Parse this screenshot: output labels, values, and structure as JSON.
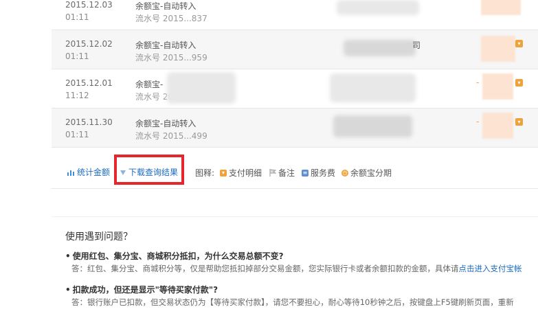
{
  "rows": [
    {
      "date": "2015.12.03",
      "time": "01:11",
      "name": "余额宝-自动转入",
      "serial": "流水号 2015...837"
    },
    {
      "date": "2015.12.02",
      "time": "01:11",
      "name": "余额宝-自动转入",
      "serial": "流水号 2015...959",
      "extra": "司"
    },
    {
      "date": "2015.12.01",
      "time": "11:12",
      "name": "余额宝-",
      "serial": "流水号 2015...736"
    },
    {
      "date": "2015.11.30",
      "time": "01:11",
      "name": "余额宝-自动转入",
      "serial": "流水号 2015...499"
    }
  ],
  "toolbar": {
    "stats_label": "统计金额",
    "download_label": "下载查询结果",
    "legend_title": "图释:",
    "legend": [
      "支付明细",
      "备注",
      "服务费",
      "余额宝分期"
    ]
  },
  "faq": {
    "title": "使用遇到问题？",
    "q1": "使用红包、集分宝、商城积分抵扣，为什么交易总额不变?",
    "a1": "答：红包、集分宝、商城积分等，仅是帮助您抵扣掉部分交易金额，您实际银行卡或者余额扣款的金额，具体请",
    "a1_link": "点击进入支付宝帐",
    "q2": "扣款成功，但还是显示\"等待买家付款\"?",
    "a2": "答：银行账户已扣款，但交易状态仍为【等待买家付款】，请您不要担心，耐心等待10秒钟之后，按键盘上F5键刷新页面，重新"
  },
  "colors": {
    "accent_orange": "#f0a23a",
    "link_blue": "#1a6bbf",
    "highlight_red": "#e5262b"
  }
}
